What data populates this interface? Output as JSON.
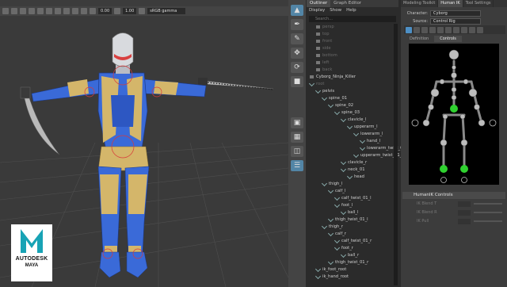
{
  "viewport": {
    "field_a": "0.00",
    "field_b": "1.00",
    "colorspace": "sRGB gamma"
  },
  "logo": {
    "brand": "AUTODESK",
    "product": "MAYA"
  },
  "outliner": {
    "tabs": [
      "Outliner",
      "Graph Editor"
    ],
    "menu": [
      "Display",
      "Show",
      "Help"
    ],
    "search_placeholder": "Search...",
    "items": [
      {
        "label": "persp",
        "depth": 1,
        "kind": "cam",
        "dim": true
      },
      {
        "label": "top",
        "depth": 1,
        "kind": "cam",
        "dim": true
      },
      {
        "label": "front",
        "depth": 1,
        "kind": "cam",
        "dim": true
      },
      {
        "label": "side",
        "depth": 1,
        "kind": "cam",
        "dim": true
      },
      {
        "label": "bottom",
        "depth": 1,
        "kind": "cam",
        "dim": true
      },
      {
        "label": "left",
        "depth": 1,
        "kind": "cam",
        "dim": true
      },
      {
        "label": "back",
        "depth": 1,
        "kind": "cam",
        "dim": true
      },
      {
        "label": "Cyborg_Ninja_Killer",
        "depth": 0,
        "kind": "grp",
        "dim": false
      },
      {
        "label": "root",
        "depth": 0,
        "kind": "jnt",
        "dim": true
      },
      {
        "label": "pelvis",
        "depth": 1,
        "kind": "jnt",
        "dim": false
      },
      {
        "label": "spine_01",
        "depth": 2,
        "kind": "jnt",
        "dim": false
      },
      {
        "label": "spine_02",
        "depth": 3,
        "kind": "jnt",
        "dim": false
      },
      {
        "label": "spine_03",
        "depth": 4,
        "kind": "jnt",
        "dim": false
      },
      {
        "label": "clavicle_l",
        "depth": 5,
        "kind": "jnt",
        "dim": false
      },
      {
        "label": "upperarm_l",
        "depth": 6,
        "kind": "jnt",
        "dim": false
      },
      {
        "label": "lowerarm_l",
        "depth": 7,
        "kind": "jnt",
        "dim": false
      },
      {
        "label": "hand_l",
        "depth": 8,
        "kind": "jnt",
        "dim": false
      },
      {
        "label": "lowerarm_twist_01_l",
        "depth": 8,
        "kind": "jnt",
        "dim": false
      },
      {
        "label": "upperarm_twist_01_l",
        "depth": 7,
        "kind": "jnt",
        "dim": false
      },
      {
        "label": "clavicle_r",
        "depth": 5,
        "kind": "jnt",
        "dim": false
      },
      {
        "label": "neck_01",
        "depth": 5,
        "kind": "jnt",
        "dim": false
      },
      {
        "label": "head",
        "depth": 6,
        "kind": "jnt",
        "dim": false
      },
      {
        "label": "thigh_l",
        "depth": 2,
        "kind": "jnt",
        "dim": false
      },
      {
        "label": "calf_l",
        "depth": 3,
        "kind": "jnt",
        "dim": false
      },
      {
        "label": "calf_twist_01_l",
        "depth": 4,
        "kind": "jnt",
        "dim": false
      },
      {
        "label": "foot_l",
        "depth": 4,
        "kind": "jnt",
        "dim": false
      },
      {
        "label": "ball_l",
        "depth": 5,
        "kind": "jnt",
        "dim": false
      },
      {
        "label": "thigh_twist_01_l",
        "depth": 3,
        "kind": "jnt",
        "dim": false
      },
      {
        "label": "thigh_r",
        "depth": 2,
        "kind": "jnt",
        "dim": false
      },
      {
        "label": "calf_r",
        "depth": 3,
        "kind": "jnt",
        "dim": false
      },
      {
        "label": "calf_twist_01_r",
        "depth": 4,
        "kind": "jnt",
        "dim": false
      },
      {
        "label": "foot_r",
        "depth": 4,
        "kind": "jnt",
        "dim": false
      },
      {
        "label": "ball_r",
        "depth": 5,
        "kind": "jnt",
        "dim": false
      },
      {
        "label": "thigh_twist_01_r",
        "depth": 3,
        "kind": "jnt",
        "dim": false
      },
      {
        "label": "ik_foot_root",
        "depth": 1,
        "kind": "jnt",
        "dim": false
      },
      {
        "label": "ik_hand_root",
        "depth": 1,
        "kind": "jnt",
        "dim": false
      }
    ]
  },
  "right_panel": {
    "tabs": [
      "Modeling Toolkit",
      "Human IK",
      "Tool Settings"
    ],
    "active_tab": "Human IK",
    "character_label": "Character:",
    "character_value": "Cyborg",
    "source_label": "Source:",
    "source_value": "Control Rig",
    "subtabs": [
      "Definition",
      "Controls"
    ],
    "active_subtab": "Controls",
    "controls_header": "HumanIK Controls",
    "controls": [
      {
        "label": "IK Blend T",
        "value": "0.00"
      },
      {
        "label": "IK Blend R",
        "value": "0.00"
      },
      {
        "label": "IK Pull",
        "value": "0.00"
      }
    ]
  },
  "colors": {
    "accent": "#5285a6",
    "rig_green": "#2fd12f",
    "bone_grey": "#9a9a9a"
  }
}
